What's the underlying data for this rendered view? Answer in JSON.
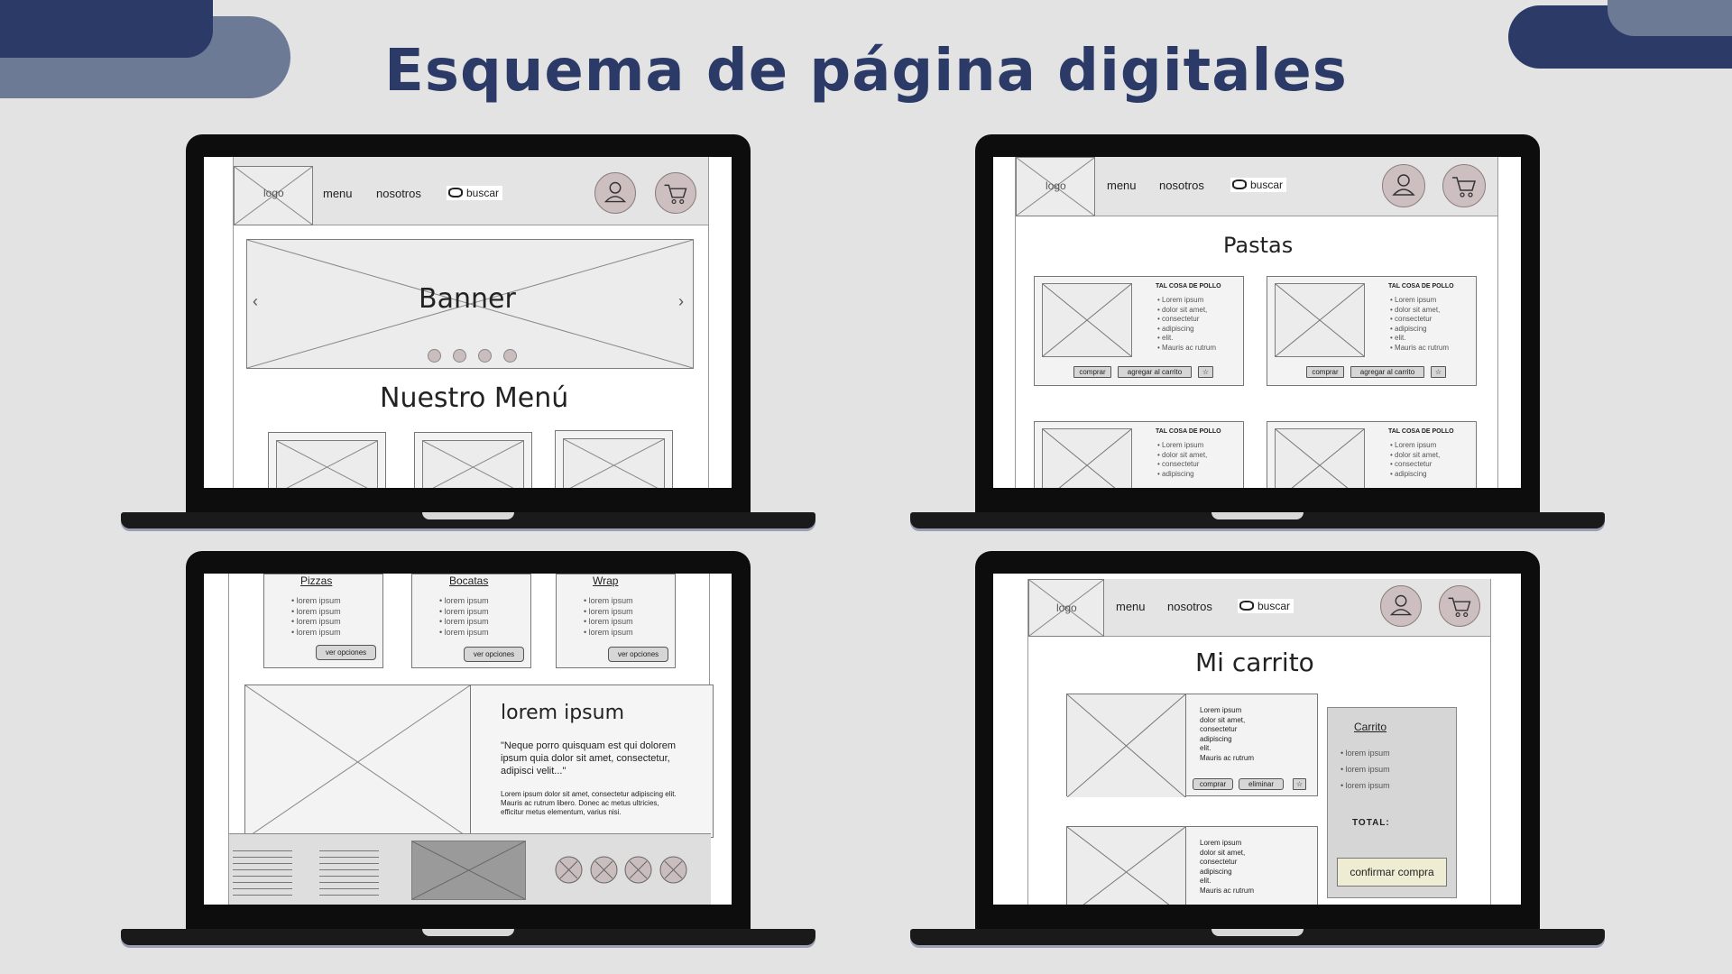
{
  "title": "Esquema de página digitales",
  "screens": {
    "home": {
      "nav": {
        "logo": "logo",
        "menu": "menu",
        "nosotros": "nosotros",
        "buscar": "buscar"
      },
      "banner": "Banner",
      "menu_title": "Nuestro Menú"
    },
    "pastas": {
      "nav": {
        "logo": "logo",
        "menu": "menu",
        "nosotros": "nosotros",
        "buscar": "buscar"
      },
      "heading": "Pastas",
      "products": [
        {
          "name": "TAL COSA DE POLLO",
          "bullets": [
            "Lorem ipsum",
            "dolor sit amet,",
            "consectetur",
            "adipiscing",
            "elit.",
            "Mauris ac rutrum"
          ],
          "buy": "comprar",
          "add": "agregar al carrito"
        },
        {
          "name": "TAL COSA DE POLLO",
          "bullets": [
            "Lorem ipsum",
            "dolor sit amet,",
            "consectetur",
            "adipiscing",
            "elit.",
            "Mauris ac rutrum"
          ],
          "buy": "comprar",
          "add": "agregar al carrito"
        },
        {
          "name": "TAL COSA DE POLLO",
          "bullets": [
            "Lorem ipsum",
            "dolor sit amet,",
            "consectetur",
            "adipiscing"
          ]
        },
        {
          "name": "TAL COSA DE POLLO",
          "bullets": [
            "Lorem ipsum",
            "dolor sit amet,",
            "consectetur",
            "adipiscing"
          ]
        }
      ]
    },
    "menu": {
      "categories": [
        {
          "name": "Pizzas",
          "items": [
            "lorem ipsum",
            "lorem ipsum",
            "lorem ipsum",
            "lorem ipsum"
          ],
          "button": "ver opciones"
        },
        {
          "name": "Bocatas",
          "items": [
            "lorem ipsum",
            "lorem ipsum",
            "lorem ipsum",
            "lorem ipsum"
          ],
          "button": "ver opciones"
        },
        {
          "name": "Wrap",
          "items": [
            "lorem ipsum",
            "lorem ipsum",
            "lorem ipsum",
            "lorem ipsum"
          ],
          "button": "ver opciones"
        }
      ],
      "feature": {
        "heading": "lorem ipsum",
        "quote": "\"Neque porro quisquam est qui dolorem ipsum quia dolor sit amet, consectetur, adipisci velit...\"",
        "body": "Lorem ipsum dolor sit amet, consectetur adipiscing elit. Mauris ac rutrum libero. Donec ac metus ultricies, efficitur metus elementum, varius nisi."
      }
    },
    "cart": {
      "nav": {
        "logo": "logo",
        "menu": "menu",
        "nosotros": "nosotros",
        "buscar": "buscar"
      },
      "heading": "Mi carrito",
      "items": [
        {
          "lines": [
            "Lorem ipsum",
            "dolor sit amet,",
            "consectetur",
            "adipiscing",
            "elit.",
            "Mauris ac rutrum"
          ],
          "buy": "comprar",
          "remove": "eliminar"
        },
        {
          "lines": [
            "Lorem ipsum",
            "dolor sit amet,",
            "consectetur",
            "adipiscing",
            "elit.",
            "Mauris ac rutrum"
          ]
        }
      ],
      "summary": {
        "title": "Carrito",
        "items": [
          "lorem ipsum",
          "lorem ipsum",
          "lorem ipsum"
        ],
        "total": "TOTAL:",
        "confirm": "confirmar compra"
      }
    }
  },
  "colors": {
    "navy": "#2b3a67",
    "slate": "#6d7a95",
    "background": "#e3e3e3",
    "confirm_button": "#eeecd2"
  }
}
